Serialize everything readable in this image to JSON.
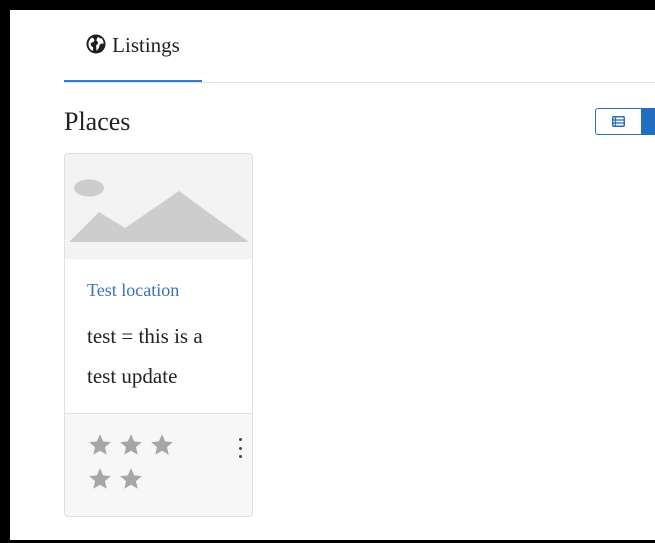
{
  "tabs": [
    {
      "label": "Listings",
      "icon": "globe-icon",
      "active": true
    }
  ],
  "section": {
    "title": "Places"
  },
  "view_toggle": {
    "list_icon": "list-view-icon",
    "grid_icon": "grid-view-icon",
    "active": "grid",
    "accent": "#1f6ebf"
  },
  "cards": [
    {
      "image_icon": "image-placeholder-icon",
      "title": "Test location",
      "description": "test = this is a test update",
      "rating": 5,
      "rating_max": 5,
      "menu_icon": "more-vertical-icon"
    }
  ],
  "colors": {
    "link": "#3a73b8",
    "tab_underline": "#3a7bc8",
    "star": "#a6a6a6"
  }
}
